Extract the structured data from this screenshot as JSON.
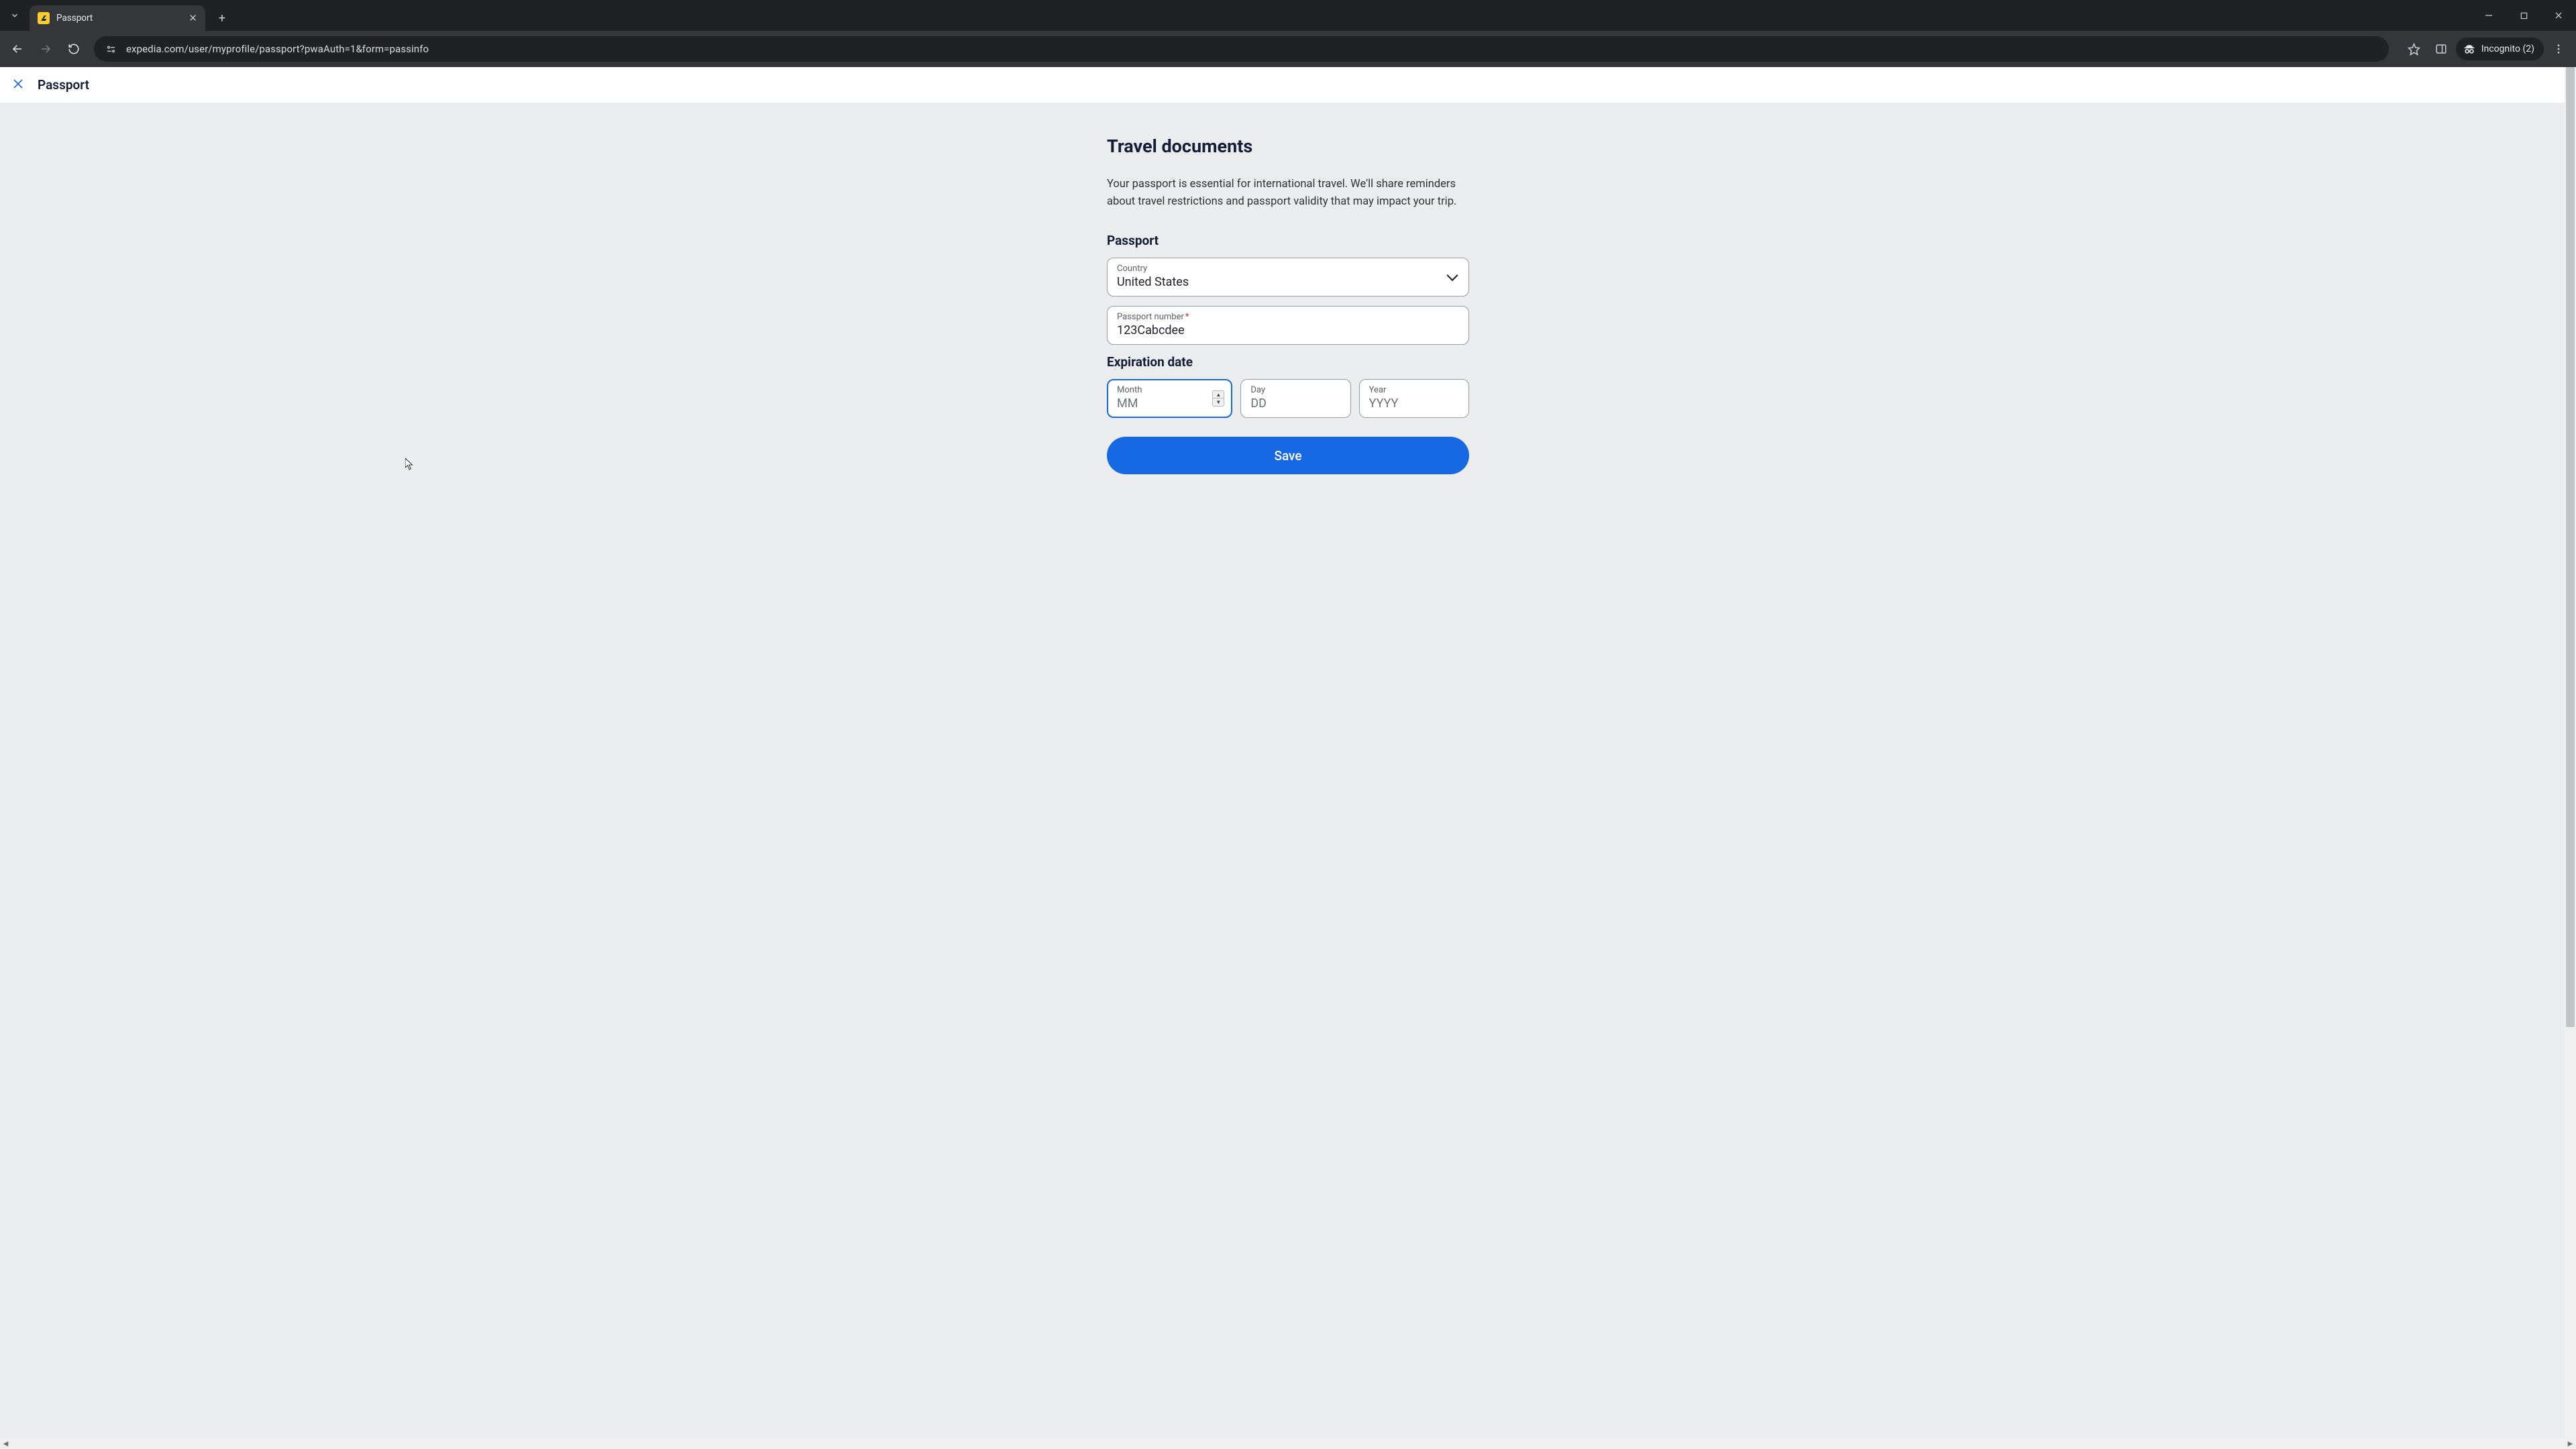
{
  "browser": {
    "tab_title": "Passport",
    "url": "expedia.com/user/myprofile/passport?pwaAuth=1&form=passinfo",
    "incognito_label": "Incognito (2)"
  },
  "page": {
    "header_title": "Passport",
    "h1": "Travel documents",
    "lead": "Your passport is essential for international travel. We'll share reminders about travel restrictions and passport validity that may impact your trip.",
    "section_passport": "Passport",
    "section_expiration": "Expiration date",
    "fields": {
      "country": {
        "label": "Country",
        "value": "United States"
      },
      "passport_number": {
        "label": "Passport number",
        "required_mark": "*",
        "value": "123Cabcdee"
      },
      "month": {
        "label": "Month",
        "placeholder": "MM",
        "value": ""
      },
      "day": {
        "label": "Day",
        "placeholder": "DD",
        "value": ""
      },
      "year": {
        "label": "Year",
        "placeholder": "YYYY",
        "value": ""
      }
    },
    "save_label": "Save"
  }
}
